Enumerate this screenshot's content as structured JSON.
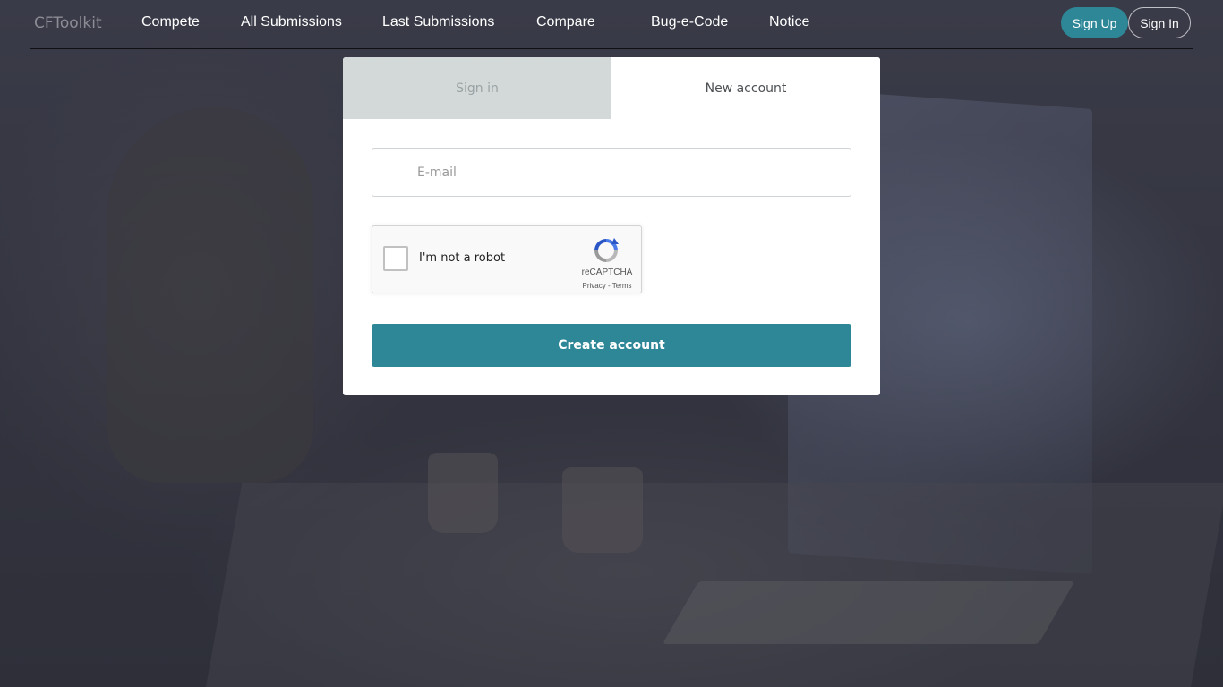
{
  "navbar": {
    "brand": "CFToolkit",
    "links": [
      {
        "label": "Compete"
      },
      {
        "label": "All Submissions"
      },
      {
        "label": "Last Submissions"
      },
      {
        "label": "Compare"
      },
      {
        "label": "Bug-e-Code"
      },
      {
        "label": "Notice"
      }
    ],
    "signup_label": "Sign Up",
    "signin_label": "Sign In"
  },
  "panel": {
    "tabs": [
      {
        "label": "Sign in",
        "active": false
      },
      {
        "label": "New account",
        "active": true
      }
    ],
    "email": {
      "placeholder": "E-mail",
      "value": ""
    },
    "captcha": {
      "label": "I'm not a robot",
      "brand": "reCAPTCHA",
      "links": "Privacy - Terms",
      "checked": false
    },
    "submit_label": "Create account"
  },
  "colors": {
    "accent": "#2e8797",
    "inactive_tab": "#d3d9d9",
    "background": "#33343f"
  }
}
